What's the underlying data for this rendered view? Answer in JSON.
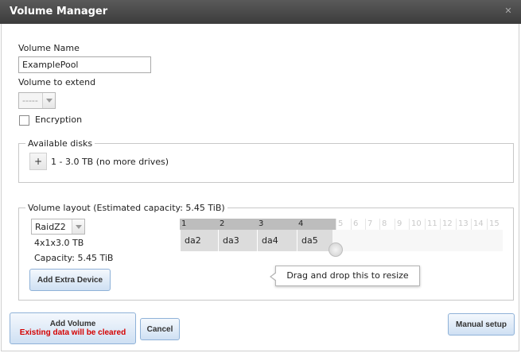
{
  "window": {
    "title": "Volume Manager",
    "close_icon": "close-icon"
  },
  "form": {
    "volume_name_label": "Volume Name",
    "volume_name_value": "ExamplePool",
    "volume_extend_label": "Volume to extend",
    "volume_extend_value": "-----",
    "encryption_label": "Encryption",
    "encryption_checked": false
  },
  "available_disks": {
    "legend": "Available disks",
    "add_symbol": "+",
    "item_label": "1 - 3.0 TB (no more drives)"
  },
  "volume_layout": {
    "legend": "Volume layout (Estimated capacity: 5.45 TiB)",
    "raid_type": "RaidZ2",
    "config_text": "4x1x3.0 TB",
    "capacity_text": "Capacity: 5.45 TiB",
    "add_extra_device_label": "Add Extra Device",
    "columns_active": [
      "1",
      "2",
      "3",
      "4"
    ],
    "columns_inactive": [
      "5",
      "6",
      "7",
      "8",
      "9",
      "10",
      "11",
      "12",
      "13",
      "14",
      "15"
    ],
    "disks": [
      "da2",
      "da3",
      "da4",
      "da5"
    ],
    "tooltip": "Drag and drop this to resize"
  },
  "buttons": {
    "add_volume_label": "Add Volume",
    "add_volume_warning": "Existing data will be cleared",
    "cancel_label": "Cancel",
    "manual_setup_label": "Manual setup"
  },
  "colors": {
    "warning": "#d40000",
    "button_border": "#8fb2d8",
    "titlebar": "#4a4a4a"
  }
}
